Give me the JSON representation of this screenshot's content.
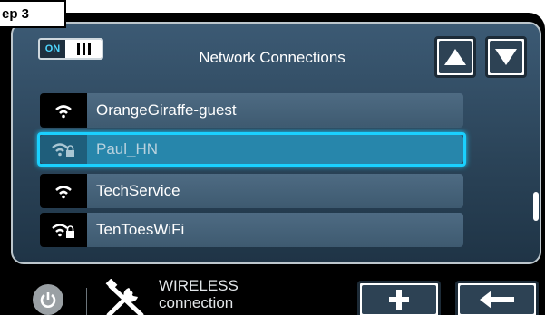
{
  "step_label": "ep 3",
  "header": {
    "toggle_on_label": "ON",
    "title": "Network Connections"
  },
  "networks": [
    {
      "name": "OrangeGiraffe-guest",
      "secured": false,
      "selected": false,
      "icon": "wifi-icon"
    },
    {
      "name": "Paul_HN",
      "secured": true,
      "selected": true,
      "icon": "wifi-lock-icon"
    },
    {
      "name": "TechService",
      "secured": false,
      "selected": false,
      "icon": "wifi-icon"
    },
    {
      "name": "TenToesWiFi",
      "secured": true,
      "selected": false,
      "icon": "wifi-lock-icon"
    }
  ],
  "footer": {
    "wireless_line1": "WIRELESS",
    "wireless_line2": "connection"
  },
  "colors": {
    "accent": "#1ad0ff",
    "panel": "#2f4a60",
    "button": "#2d4254"
  }
}
